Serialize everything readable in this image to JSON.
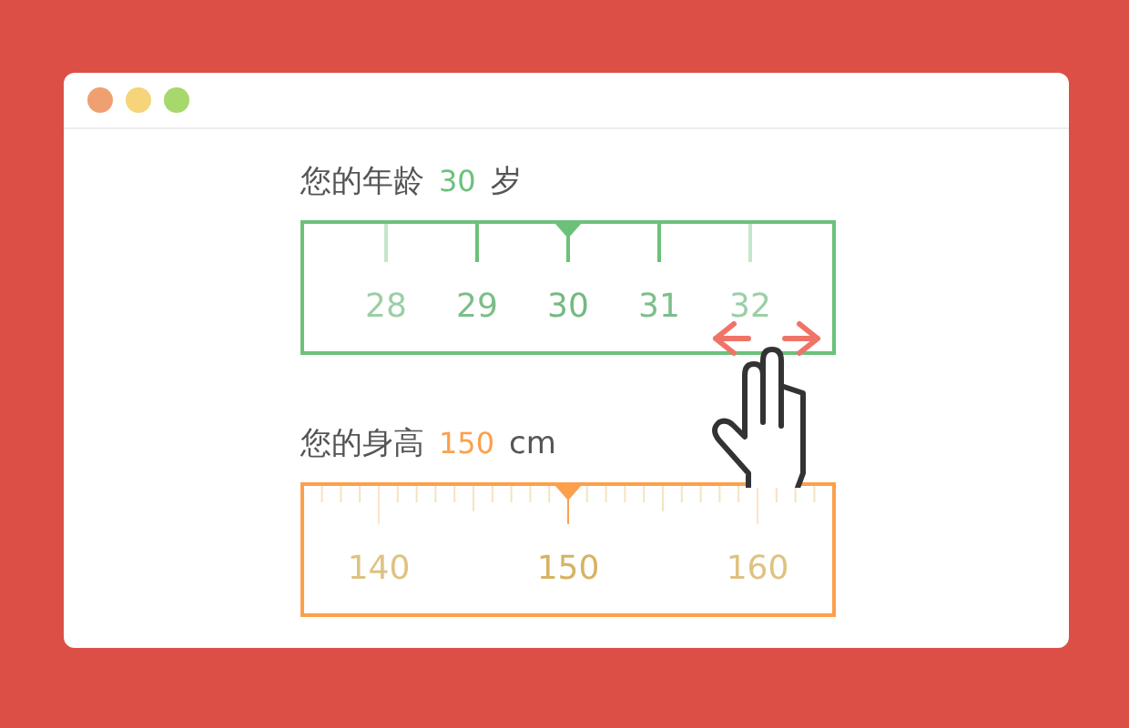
{
  "window": {
    "controls": [
      {
        "color": "#f0a070"
      },
      {
        "color": "#f5d47a"
      },
      {
        "color": "#a6d86c"
      }
    ]
  },
  "fields": [
    {
      "label": "您的年龄",
      "value": "30",
      "unit": "岁",
      "color": "#6cc17a",
      "kind": "coarse",
      "ticks": [
        "28",
        "29",
        "30",
        "31",
        "32"
      ]
    },
    {
      "label": "您的身高",
      "value": "150",
      "unit": "cm",
      "color": "#fca04c",
      "kind": "fine",
      "ticks": [
        "140",
        "150",
        "160"
      ]
    }
  ]
}
